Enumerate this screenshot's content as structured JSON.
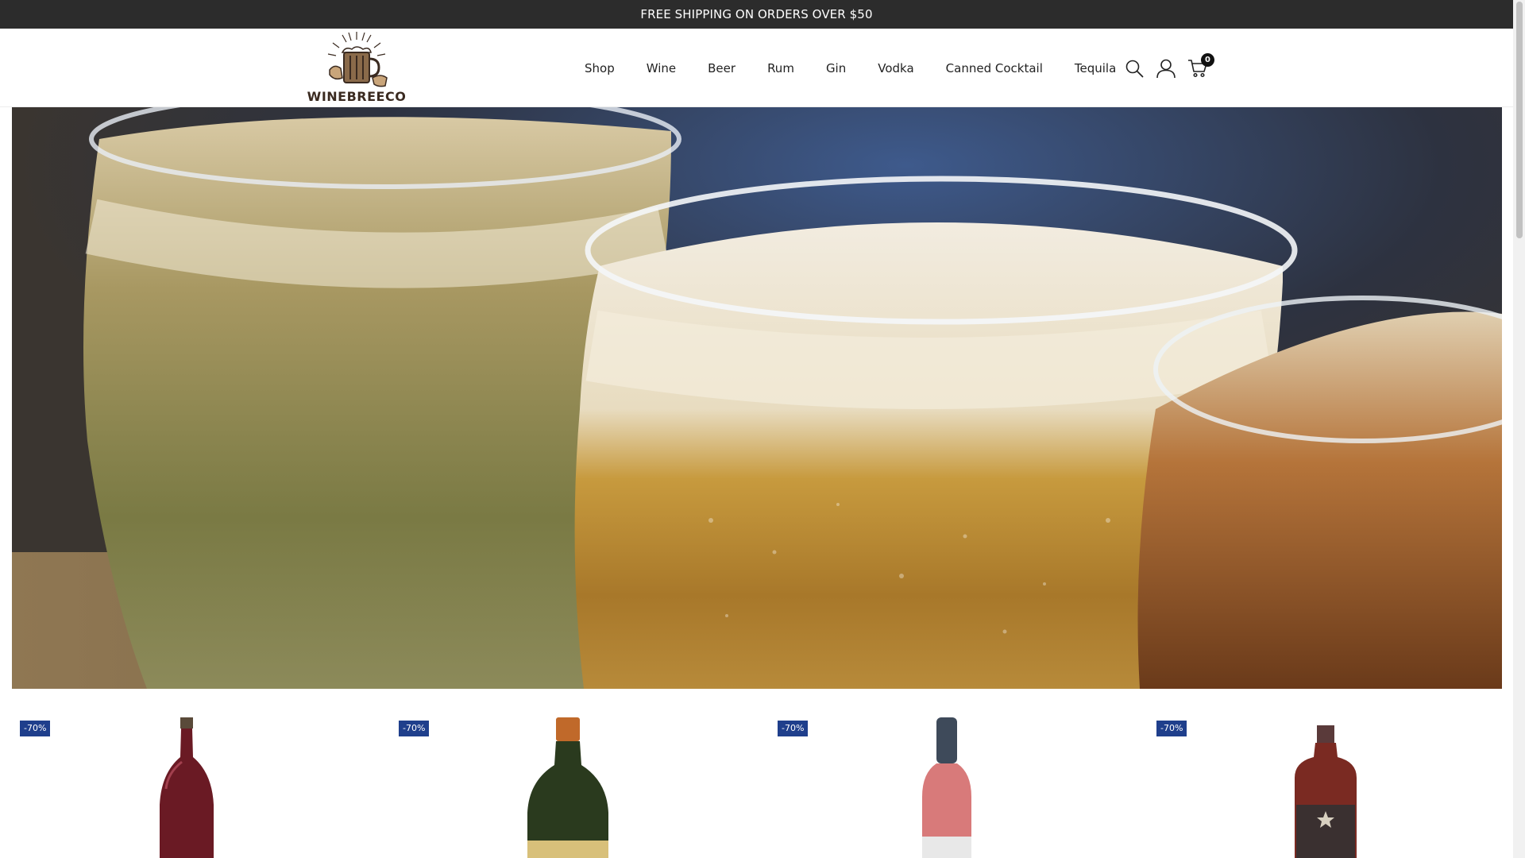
{
  "promo": {
    "text": "FREE SHIPPING ON ORDERS OVER $50"
  },
  "header": {
    "logo_text": "WINEBREECO",
    "nav": [
      "Shop",
      "Wine",
      "Beer",
      "Rum",
      "Gin",
      "Vodka",
      "Canned Cocktail",
      "Tequila"
    ],
    "cart_count": "0"
  },
  "icons": {
    "search": "search-icon",
    "account": "user-icon",
    "cart": "cart-icon"
  },
  "hero": {
    "image": "beer-glasses-photo"
  },
  "products": [
    {
      "badge": "-70%",
      "image": "red-wine-bottle"
    },
    {
      "badge": "-70%",
      "image": "green-whiskey-bottle"
    },
    {
      "badge": "-70%",
      "image": "rose-bottle"
    },
    {
      "badge": "-70%",
      "image": "starlight-bottle"
    }
  ],
  "colors": {
    "promo_bg": "#2c2c2c",
    "badge_bg": "#1f3f8c"
  }
}
